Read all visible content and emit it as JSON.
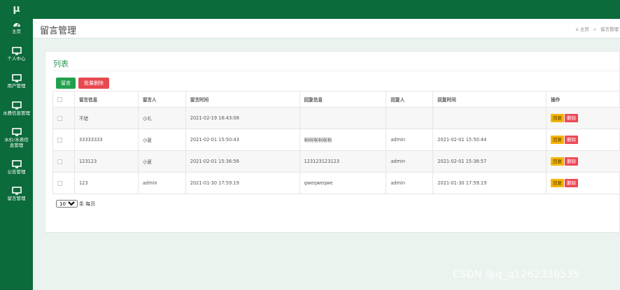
{
  "sidebar": {
    "logo": "μ",
    "items": [
      {
        "label": "主页",
        "icon": "dashboard-icon"
      },
      {
        "label": "个人中心",
        "icon": "monitor-icon"
      },
      {
        "label": "用户管理",
        "icon": "monitor-icon"
      },
      {
        "label": "水费信息管理",
        "icon": "monitor-icon"
      },
      {
        "label": "水价/水表信息管理",
        "icon": "monitor-icon"
      },
      {
        "label": "公告管理",
        "icon": "monitor-icon"
      },
      {
        "label": "留言管理",
        "icon": "monitor-icon"
      }
    ]
  },
  "header": {
    "title": "留言管理",
    "breadcrumb": {
      "home": "主页",
      "separator": "»",
      "current": "留言管理"
    }
  },
  "card": {
    "title": "列表",
    "add_label": "留言",
    "batch_delete_label": "批量删除"
  },
  "table": {
    "headers": [
      "",
      "留言信息",
      "留言人",
      "留言时间",
      "回复信息",
      "回复人",
      "回复时间",
      "操作"
    ],
    "rows": [
      {
        "message": "不错",
        "author": "小礼",
        "time": "2021-02-19 16:43:08",
        "reply": "",
        "replier": "",
        "reply_time": ""
      },
      {
        "message": "33333333",
        "author": "小夏",
        "time": "2021-02-01 15:50:43",
        "reply": "啊啊啊啊啊啊",
        "replier": "admin",
        "reply_time": "2021-02-01 15:50:44"
      },
      {
        "message": "123123",
        "author": "小夏",
        "time": "2021-02-01 15:36:56",
        "reply": "123123123123",
        "replier": "admin",
        "reply_time": "2021-02-01 15:36:57"
      },
      {
        "message": "123",
        "author": "admin",
        "time": "2021-01-30 17:59:19",
        "reply": "qweqweqwe",
        "replier": "admin",
        "reply_time": "2021-01-30 17:59:19"
      }
    ],
    "reply_label": "回复",
    "delete_label": "删除"
  },
  "pagination": {
    "page_size": "10",
    "suffix": "条 每页"
  },
  "watermark": "CSDN @q_q1262330535",
  "colors": {
    "sidebar": "#0b6b3a",
    "accent": "#21a04c",
    "danger": "#e8484f",
    "warning": "#f6b400"
  }
}
